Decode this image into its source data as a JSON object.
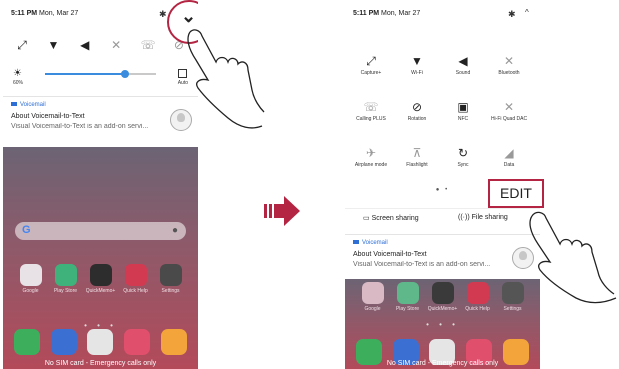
{
  "left": {
    "status_time": "5:11 PM",
    "status_date": "Mon, Mar 27",
    "brightness_percent": "60%",
    "brightness_level": 0.72,
    "auto_label": "Auto",
    "notification": {
      "app": "Voicemail",
      "title": "About Voicemail-to-Text",
      "body": "Visual Voicemail-to-Text is an add-on servi..."
    },
    "apps": [
      "Google",
      "Play Store",
      "QuickMemo+",
      "Quick Help",
      "Settings"
    ],
    "no_sim": "No SIM card - Emergency calls only"
  },
  "right": {
    "status_time": "5:11 PM",
    "status_date": "Mon, Mar 27",
    "tiles": [
      {
        "label": "Capture+",
        "icon": "capture-icon"
      },
      {
        "label": "Wi-Fi",
        "icon": "wifi-icon"
      },
      {
        "label": "Sound",
        "icon": "sound-icon"
      },
      {
        "label": "Bluetooth",
        "icon": "bluetooth-icon"
      },
      {
        "label": "Calling PLUS",
        "icon": "calling-plus-icon"
      },
      {
        "label": "Rotation",
        "icon": "rotation-icon"
      },
      {
        "label": "NFC",
        "icon": "nfc-icon"
      },
      {
        "label": "Hi-Fi Quad DAC",
        "icon": "hifi-icon"
      },
      {
        "label": "Airplane mode",
        "icon": "airplane-icon"
      },
      {
        "label": "Flashlight",
        "icon": "flashlight-icon"
      },
      {
        "label": "Sync",
        "icon": "sync-icon"
      },
      {
        "label": "Data",
        "icon": "data-icon"
      }
    ],
    "edit_label": "EDIT",
    "screen_sharing": "Screen sharing",
    "file_sharing": "File sharing",
    "notification": {
      "app": "Voicemail",
      "title": "About Voicemail-to-Text",
      "body": "Visual Voicemail-to-Text is an add-on servi..."
    },
    "apps": [
      "Google",
      "Play Store",
      "QuickMemo+",
      "Quick Help",
      "Settings"
    ],
    "no_sim": "No SIM card - Emergency calls only"
  }
}
